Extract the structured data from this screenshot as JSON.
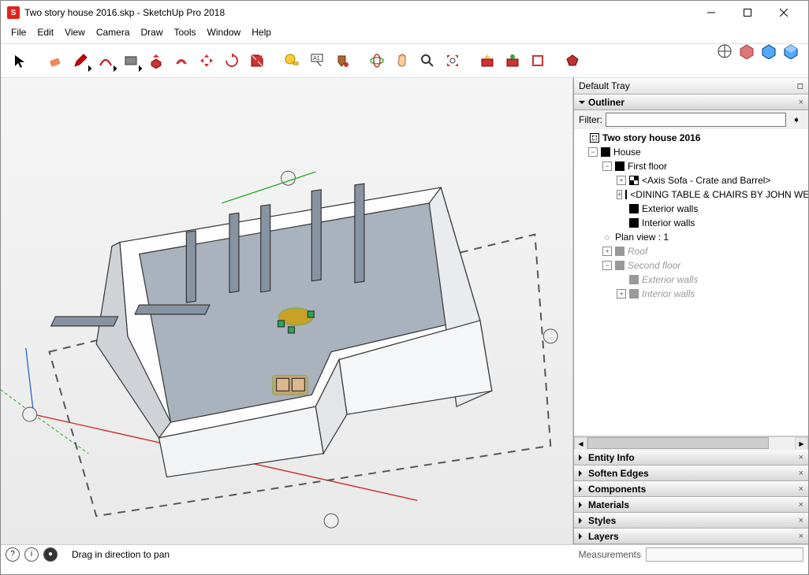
{
  "window": {
    "title": "Two story house 2016.skp - SketchUp Pro 2018"
  },
  "menu": [
    "File",
    "Edit",
    "View",
    "Camera",
    "Draw",
    "Tools",
    "Window",
    "Help"
  ],
  "tray": {
    "title": "Default Tray",
    "outliner": {
      "title": "Outliner",
      "filter_label": "Filter:",
      "filter_value": "",
      "root": "Two story house 2016",
      "house": "House",
      "first_floor": "First floor",
      "sofa": "<Axis Sofa - Crate and Barrel>",
      "dining": "<DINING TABLE & CHAIRS BY JOHN WEICK",
      "ext_walls": "Exterior walls",
      "int_walls": "Interior walls",
      "plan_view": "Plan view : 1",
      "roof": "Roof",
      "second_floor": "Second floor",
      "ext_walls2": "Exterior walls",
      "int_walls2": "Interior walls"
    },
    "panels": {
      "entity_info": "Entity Info",
      "soften": "Soften Edges",
      "components": "Components",
      "materials": "Materials",
      "styles": "Styles",
      "layers": "Layers"
    }
  },
  "status": {
    "hint": "Drag in direction to pan",
    "measurements_label": "Measurements"
  },
  "toolbar_icons": [
    "select-arrow",
    "eraser",
    "pencil",
    "arc",
    "rectangle",
    "push-pull",
    "offset",
    "move",
    "rotate",
    "scale",
    "tape-measure",
    "text-label",
    "paint-bucket",
    "orbit",
    "pan-hand",
    "zoom",
    "zoom-extents",
    "walk",
    "3d-warehouse",
    "extension-warehouse",
    "layout",
    "extension-manager"
  ]
}
